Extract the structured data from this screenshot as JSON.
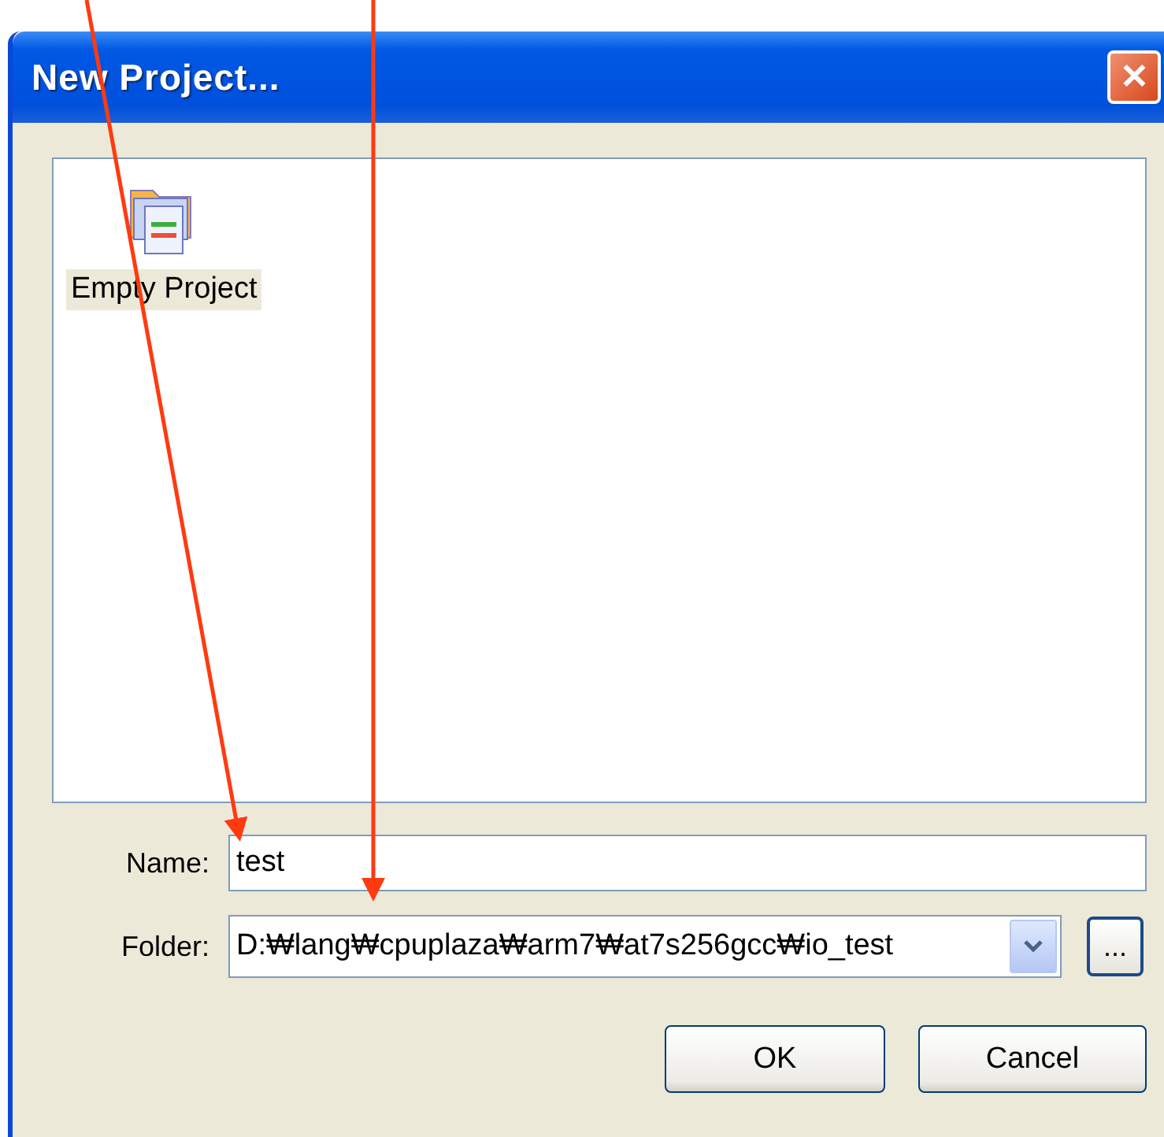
{
  "window": {
    "title": "New Project...",
    "close": "✕"
  },
  "templates": [
    {
      "label": "Empty Project",
      "selected": true
    }
  ],
  "name": {
    "label": "Name:",
    "value": "test"
  },
  "folder": {
    "label": "Folder:",
    "value": "D:₩lang₩cpuplaza₩arm7₩at7s256gcc₩io_test",
    "browse": "..."
  },
  "buttons": [
    "OK",
    "Cancel"
  ]
}
